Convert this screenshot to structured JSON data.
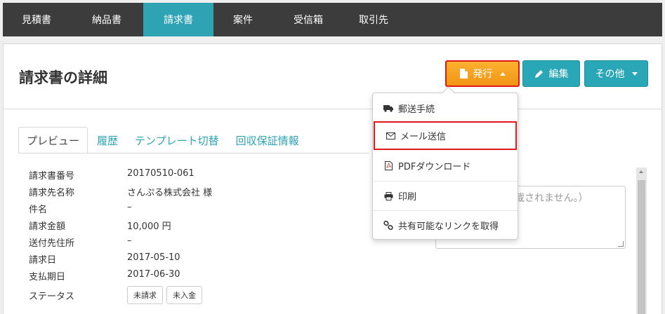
{
  "nav": {
    "items": [
      {
        "label": "見積書",
        "active": false
      },
      {
        "label": "納品書",
        "active": false
      },
      {
        "label": "請求書",
        "active": true
      },
      {
        "label": "案件",
        "active": false
      },
      {
        "label": "受信箱",
        "active": false
      },
      {
        "label": "取引先",
        "active": false
      }
    ]
  },
  "page": {
    "title": "請求書の詳細"
  },
  "actions": {
    "issue_label": "発行",
    "edit_label": "編集",
    "other_label": "その他"
  },
  "tabs": [
    {
      "label": "プレビュー",
      "active": true
    },
    {
      "label": "履歴",
      "active": false
    },
    {
      "label": "テンプレート切替",
      "active": false
    },
    {
      "label": "回収保証情報",
      "active": false
    }
  ],
  "details": [
    {
      "label": "請求書番号",
      "value": "20170510-061"
    },
    {
      "label": "請求先名称",
      "value": "さんぷる株式会社 様"
    },
    {
      "label": "件名",
      "value": "–"
    },
    {
      "label": "請求金額",
      "value": "10,000 円"
    },
    {
      "label": "送付先住所",
      "value": "–"
    },
    {
      "label": "請求日",
      "value": "2017-05-10"
    },
    {
      "label": "支払期日",
      "value": "2017-06-30"
    }
  ],
  "status": {
    "label": "ステータス",
    "badges": [
      "未請求",
      "未入金"
    ]
  },
  "memo": {
    "visible_text": "載されません。）"
  },
  "dropdown": {
    "items": [
      {
        "label": "郵送手続",
        "icon": "truck-icon"
      },
      {
        "label": "メール送信",
        "icon": "envelope-icon"
      },
      {
        "label": "PDFダウンロード",
        "icon": "pdf-file-icon"
      },
      {
        "label": "印刷",
        "icon": "print-icon"
      },
      {
        "label": "共有可能なリンクを取得",
        "icon": "link-icon"
      }
    ]
  },
  "colors": {
    "nav_bg": "#3c3c3c",
    "nav_active": "#2ea3b4",
    "issue_button": "#f7a21c",
    "accent": "#2aa7b6",
    "highlight_border": "#e01818"
  }
}
